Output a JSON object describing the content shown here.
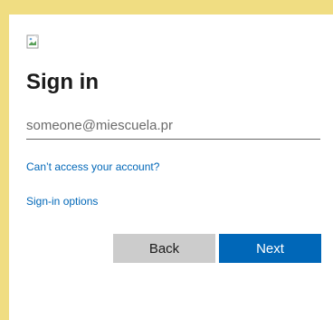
{
  "header": {
    "logo_icon": "broken-image-icon"
  },
  "form": {
    "title": "Sign in",
    "email": {
      "placeholder": "someone@miescuela.pr",
      "value": ""
    },
    "links": {
      "cant_access": "Can’t access your account?",
      "signin_options": "Sign-in options"
    },
    "buttons": {
      "back": "Back",
      "next": "Next"
    }
  },
  "colors": {
    "background": "#f0dd82",
    "accent": "#0067b8",
    "secondary_button": "#cccccc"
  }
}
